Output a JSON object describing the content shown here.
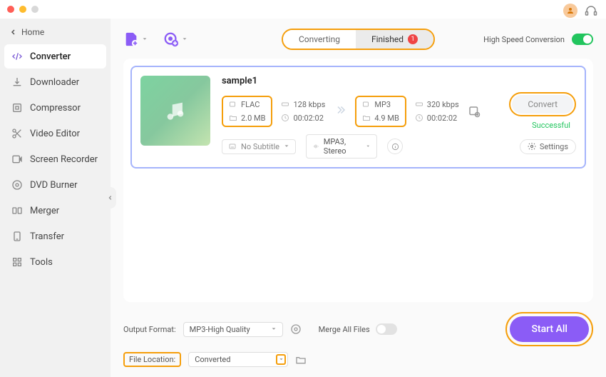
{
  "titlebar": {},
  "sidebar": {
    "home_label": "Home",
    "items": [
      {
        "label": "Converter"
      },
      {
        "label": "Downloader"
      },
      {
        "label": "Compressor"
      },
      {
        "label": "Video Editor"
      },
      {
        "label": "Screen Recorder"
      },
      {
        "label": "DVD Burner"
      },
      {
        "label": "Merger"
      },
      {
        "label": "Transfer"
      },
      {
        "label": "Tools"
      }
    ]
  },
  "toolbar": {
    "tabs": {
      "converting": "Converting",
      "finished": "Finished",
      "finished_count": "1"
    },
    "hsc_label": "High Speed Conversion"
  },
  "file": {
    "name": "sample1",
    "src": {
      "format": "FLAC",
      "bitrate": "128 kbps",
      "size": "2.0 MB",
      "duration": "00:02:02"
    },
    "dst": {
      "format": "MP3",
      "bitrate": "320 kbps",
      "size": "4.9 MB",
      "duration": "00:02:02"
    },
    "convert_label": "Convert",
    "status": "Successful",
    "subtitle_label": "No Subtitle",
    "profile_label": "MPA3, Stereo",
    "settings_label": "Settings"
  },
  "footer": {
    "output_format_label": "Output Format:",
    "output_format_value": "MP3-High Quality",
    "file_location_label": "File Location:",
    "file_location_value": "Converted",
    "merge_label": "Merge All Files",
    "start_label": "Start All"
  }
}
